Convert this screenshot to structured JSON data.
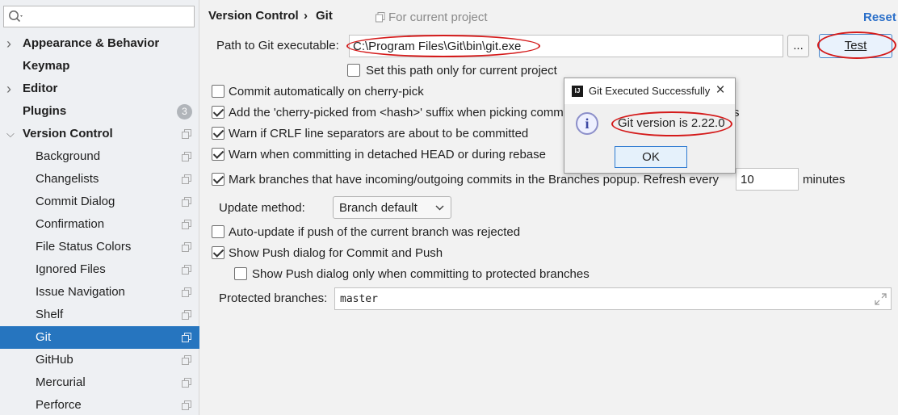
{
  "sidebar": {
    "search": {
      "placeholder": ""
    },
    "items": [
      {
        "label": "Appearance & Behavior",
        "level": 0,
        "expandable": true,
        "expanded": false
      },
      {
        "label": "Keymap",
        "level": 0,
        "expandable": false
      },
      {
        "label": "Editor",
        "level": 0,
        "expandable": true,
        "expanded": false
      },
      {
        "label": "Plugins",
        "level": 0,
        "expandable": false,
        "badge": "3"
      },
      {
        "label": "Version Control",
        "level": 0,
        "expandable": true,
        "expanded": true
      },
      {
        "label": "Background",
        "level": 1
      },
      {
        "label": "Changelists",
        "level": 1
      },
      {
        "label": "Commit Dialog",
        "level": 1
      },
      {
        "label": "Confirmation",
        "level": 1
      },
      {
        "label": "File Status Colors",
        "level": 1
      },
      {
        "label": "Ignored Files",
        "level": 1
      },
      {
        "label": "Issue Navigation",
        "level": 1
      },
      {
        "label": "Shelf",
        "level": 1
      },
      {
        "label": "Git",
        "level": 1,
        "selected": true
      },
      {
        "label": "GitHub",
        "level": 1
      },
      {
        "label": "Mercurial",
        "level": 1
      },
      {
        "label": "Perforce",
        "level": 1
      }
    ]
  },
  "header": {
    "breadcrumb_parent": "Version Control",
    "breadcrumb_sep": "›",
    "breadcrumb_current": "Git",
    "scope_note": "For current project",
    "reset": "Reset"
  },
  "git": {
    "path_label": "Path to Git executable:",
    "path_value": "C:\\Program Files\\Git\\bin\\git.exe",
    "browse": "...",
    "test": "Test",
    "set_path_current": "Set this path only for current project",
    "commit_cherry_pick": "Commit automatically on cherry-pick",
    "cherry_suffix": "Add the 'cherry-picked from <hash>' suffix when picking commits pushed to protected branches",
    "warn_crlf": "Warn if CRLF line separators are about to be committed",
    "warn_detached": "Warn when committing in detached HEAD or during rebase",
    "mark_branches": "Mark branches that have incoming/outgoing commits in the Branches popup.  Refresh every",
    "refresh_value": "10",
    "refresh_unit": "minutes",
    "update_method_label": "Update method:",
    "update_method_value": "Branch default",
    "auto_update": "Auto-update if push of the current branch was rejected",
    "show_push_dialog": "Show Push dialog for Commit and Push",
    "show_push_protected": "Show Push dialog only when committing to protected branches",
    "protected_label": "Protected branches:",
    "protected_value": "master"
  },
  "checks": {
    "set_path_current": false,
    "commit_cherry_pick": false,
    "cherry_suffix": true,
    "warn_crlf": true,
    "warn_detached": true,
    "mark_branches": true,
    "auto_update": false,
    "show_push_dialog": true,
    "show_push_protected": false
  },
  "dialog": {
    "title": "Git Executed Successfully",
    "message": "Git version is 2.22.0",
    "ok": "OK",
    "logo": "IJ"
  },
  "colors": {
    "selection": "#2675bf",
    "link": "#2a6fc9",
    "annotation_ring": "#d41a1a"
  },
  "icons": [
    "search-icon",
    "chevron-right-icon",
    "chevron-down-icon",
    "copy-project-icon",
    "close-icon",
    "info-icon",
    "expand-icon",
    "dropdown-arrow-icon"
  ]
}
